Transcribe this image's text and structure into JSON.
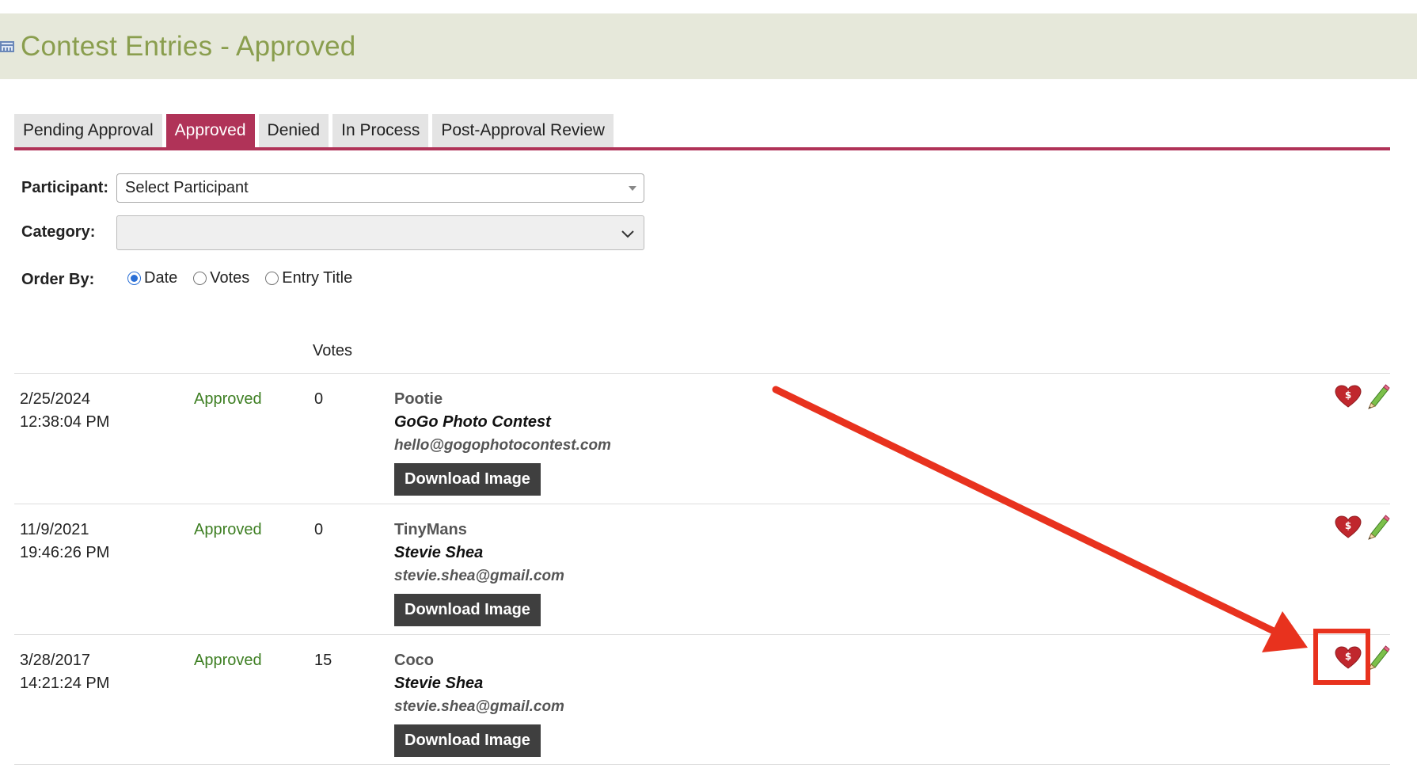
{
  "header": {
    "title": "Contest Entries - Approved",
    "icon": "calendar-icon"
  },
  "tabs": [
    {
      "label": "Pending Approval",
      "active": false
    },
    {
      "label": "Approved",
      "active": true
    },
    {
      "label": "Denied",
      "active": false
    },
    {
      "label": "In Process",
      "active": false
    },
    {
      "label": "Post-Approval Review",
      "active": false
    }
  ],
  "filters": {
    "participant_label": "Participant:",
    "participant_value": "Select Participant",
    "category_label": "Category:",
    "category_value": "",
    "order_by_label": "Order By:",
    "order_options": [
      {
        "label": "Date",
        "checked": true
      },
      {
        "label": "Votes",
        "checked": false
      },
      {
        "label": "Entry Title",
        "checked": false
      }
    ]
  },
  "table": {
    "votes_header": "Votes",
    "rows": [
      {
        "date": "2/25/2024",
        "time": "12:38:04 PM",
        "status": "Approved",
        "votes": "0",
        "title": "Pootie",
        "author": "GoGo  Photo Contest",
        "email": "hello@gogophotocontest.com",
        "download_label": "Download Image"
      },
      {
        "date": "11/9/2021",
        "time": "19:46:26 PM",
        "status": "Approved",
        "votes": "0",
        "title": "TinyMans",
        "author": "Stevie Shea",
        "email": "stevie.shea@gmail.com",
        "download_label": "Download Image"
      },
      {
        "date": "3/28/2017",
        "time": "14:21:24 PM",
        "status": "Approved",
        "votes": "15",
        "title": "Coco",
        "author": "Stevie Shea",
        "email": "stevie.shea@gmail.com",
        "download_label": "Download Image"
      }
    ],
    "action_icons": [
      "heart-dollar-icon",
      "pencil-icon"
    ]
  },
  "colors": {
    "header_bg": "#e6e8da",
    "title": "#8a9e4e",
    "tab_active": "#b03358",
    "status_approved": "#3e7f23",
    "annotation_red": "#e8321e",
    "heart_red": "#c0272d"
  },
  "annotation": {
    "type": "arrow-with-highlight",
    "target": "heart-dollar-icon row 3"
  }
}
